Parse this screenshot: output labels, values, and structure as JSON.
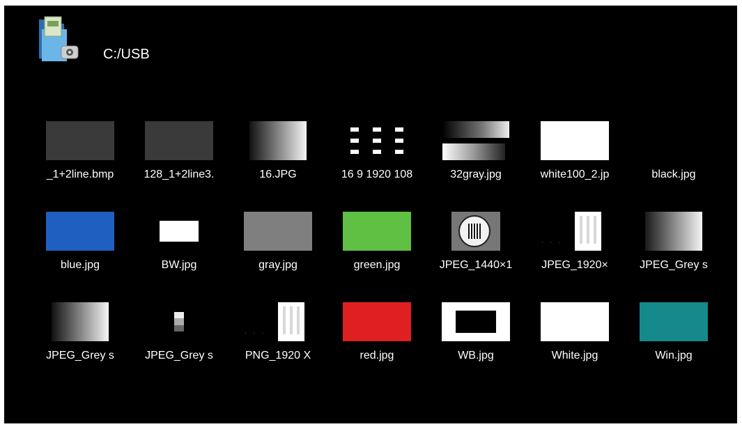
{
  "header": {
    "path": "C:/USB",
    "icon": "usb-folder-icon"
  },
  "files": [
    {
      "name": "_1+2line.bmp",
      "thumb": "solid",
      "color": "#3a3a3a"
    },
    {
      "name": "128_1+2line3.",
      "thumb": "solid",
      "color": "#3a3a3a"
    },
    {
      "name": "16.JPG",
      "thumb": "gradient",
      "gradient": "linear-gradient(90deg, #111111, #f5f5f5)"
    },
    {
      "name": "16 9 1920 108",
      "thumb": "dots"
    },
    {
      "name": "32gray.jpg",
      "thumb": "gray32"
    },
    {
      "name": "white100_2.jp",
      "thumb": "solid",
      "color": "#ffffff"
    },
    {
      "name": "black.jpg",
      "thumb": "solid",
      "color": "#000000"
    },
    {
      "name": "blue.jpg",
      "thumb": "solid",
      "color": "#1f5fbf"
    },
    {
      "name": "BW.jpg",
      "thumb": "small-white"
    },
    {
      "name": "gray.jpg",
      "thumb": "solid",
      "color": "#7f7f7f"
    },
    {
      "name": "green.jpg",
      "thumb": "solid",
      "color": "#5fc043"
    },
    {
      "name": "JPEG_1440×1",
      "thumb": "testcard"
    },
    {
      "name": "JPEG_1920×",
      "thumb": "bars"
    },
    {
      "name": "JPEG_Grey s",
      "thumb": "gradient",
      "gradient": "linear-gradient(90deg, #1a1a1a, #f5f5f5)"
    },
    {
      "name": "JPEG_Grey s",
      "thumb": "gradient",
      "gradient": "linear-gradient(90deg, #111111, #f5f5f5)"
    },
    {
      "name": "JPEG_Grey s",
      "thumb": "stack"
    },
    {
      "name": "PNG_1920 X",
      "thumb": "bars"
    },
    {
      "name": "red.jpg",
      "thumb": "solid",
      "color": "#e02020"
    },
    {
      "name": "WB.jpg",
      "thumb": "wb"
    },
    {
      "name": "White.jpg",
      "thumb": "solid",
      "color": "#ffffff"
    },
    {
      "name": "Win.jpg",
      "thumb": "solid",
      "color": "#15898c"
    }
  ]
}
